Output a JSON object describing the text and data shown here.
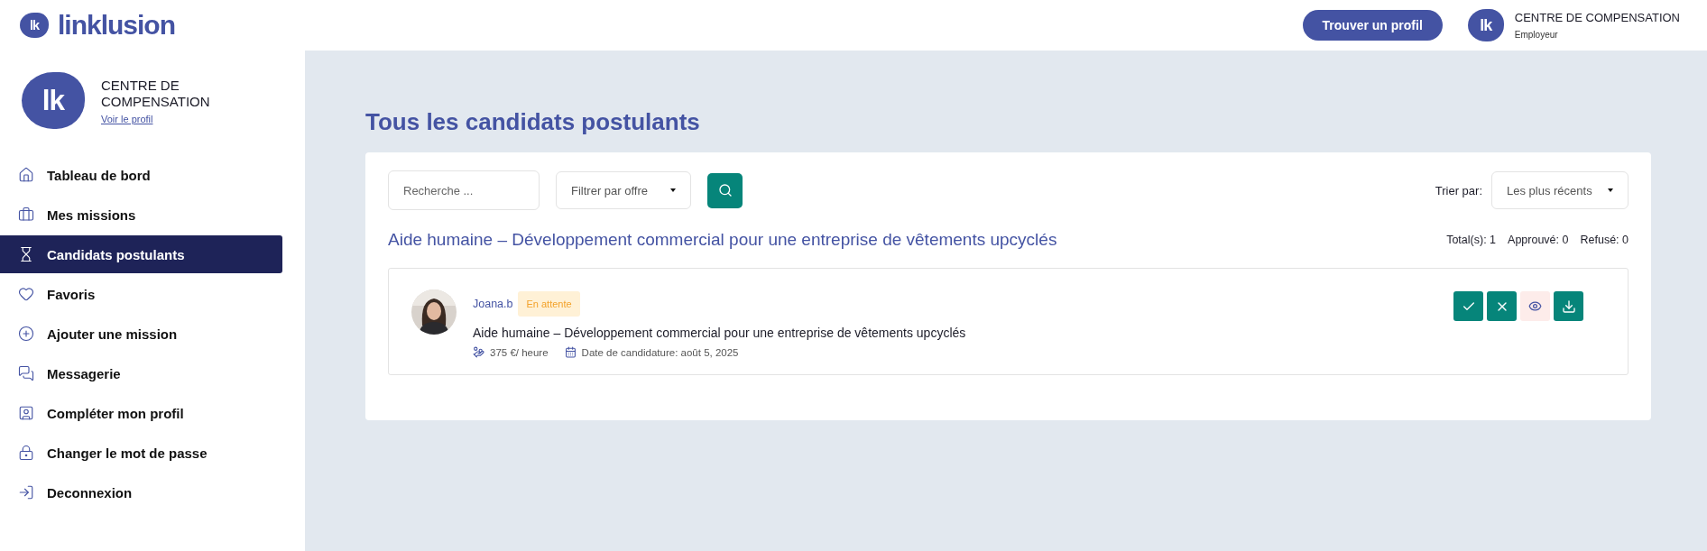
{
  "header": {
    "logo_mark": "lk",
    "logo_text": "linklusion",
    "find_button": "Trouver un profil",
    "account": {
      "logo_mark": "lk",
      "name": "CENTRE DE COMPENSATION",
      "role": "Employeur"
    }
  },
  "sidebar": {
    "profile": {
      "logo_mark": "lk",
      "name": "CENTRE DE COMPENSATION",
      "link": "Voir le profil"
    },
    "items": [
      {
        "label": "Tableau de bord",
        "selected": false
      },
      {
        "label": "Mes missions",
        "selected": false
      },
      {
        "label": "Candidats postulants",
        "selected": true
      },
      {
        "label": "Favoris",
        "selected": false
      },
      {
        "label": "Ajouter une mission",
        "selected": false
      },
      {
        "label": "Messagerie",
        "selected": false
      },
      {
        "label": "Compléter mon profil",
        "selected": false
      },
      {
        "label": "Changer le mot de passe",
        "selected": false
      },
      {
        "label": "Deconnexion",
        "selected": false
      }
    ]
  },
  "page_title": "Tous les candidats postulants",
  "filters": {
    "search": {
      "placeholder": "Recherche ..."
    },
    "offer_filter": "Filtrer par offre",
    "sort_label": "Trier par:",
    "sort_value": "Les plus récents"
  },
  "offer": {
    "title": "Aide humaine – Développement commercial pour une entreprise de vêtements upcyclés",
    "counts": [
      "Total(s): 1",
      "Approuvé: 0",
      "Refusé: 0"
    ]
  },
  "candidates": [
    {
      "name": "Joana.b",
      "status": "En attente",
      "mission": "Aide humaine – Développement commercial pour une entreprise de vêtements upcyclés",
      "rate": "375 €/ heure",
      "date": "Date de candidature: août 5, 2025"
    }
  ]
}
